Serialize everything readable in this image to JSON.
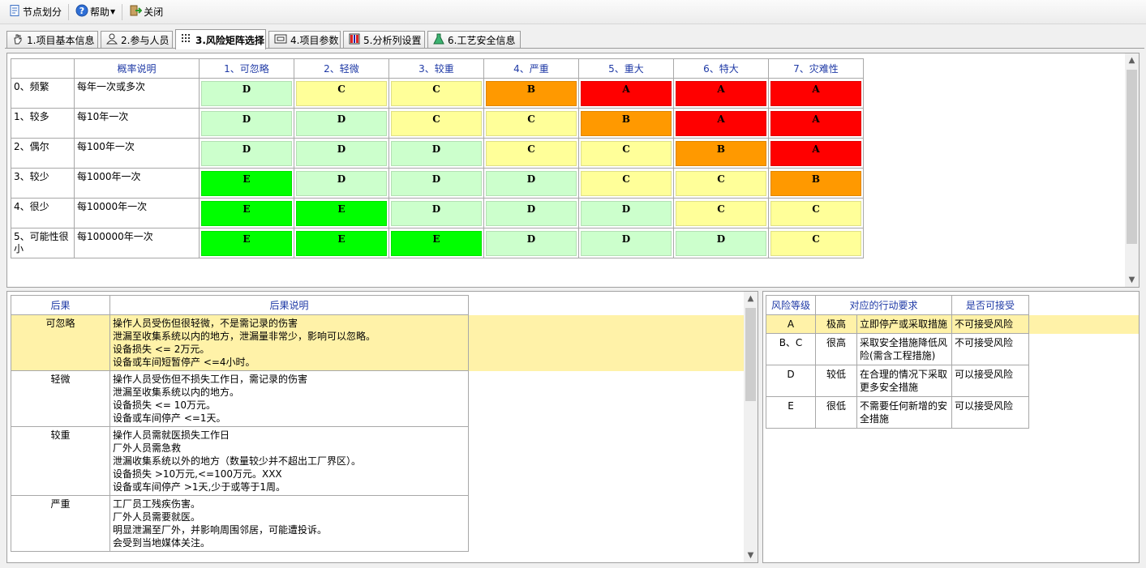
{
  "toolbar": {
    "node_split": "节点划分",
    "help": "帮助",
    "close": "关闭"
  },
  "tabs": [
    {
      "label": "1.项目基本信息",
      "icon": "hand-icon"
    },
    {
      "label": "2.参与人员",
      "icon": "people-icon"
    },
    {
      "label": "3.风险矩阵选择",
      "icon": "grid-icon"
    },
    {
      "label": "4.项目参数",
      "icon": "parameter-icon"
    },
    {
      "label": "5.分析列设置",
      "icon": "columns-icon"
    },
    {
      "label": "6.工艺安全信息",
      "icon": "flask-icon"
    }
  ],
  "active_tab": 2,
  "matrix": {
    "header_prob": "概率说明",
    "columns": [
      "1、可忽略",
      "2、轻微",
      "3、较重",
      "4、严重",
      "5、重大",
      "6、特大",
      "7、灾难性"
    ],
    "rows": [
      {
        "label": "0、频繁",
        "desc": "每年一次或多次",
        "cells": [
          "D",
          "C",
          "C",
          "B",
          "A",
          "A",
          "A"
        ]
      },
      {
        "label": "1、较多",
        "desc": "每10年一次",
        "cells": [
          "D",
          "D",
          "C",
          "C",
          "B",
          "A",
          "A"
        ]
      },
      {
        "label": "2、偶尔",
        "desc": "每100年一次",
        "cells": [
          "D",
          "D",
          "D",
          "C",
          "C",
          "B",
          "A"
        ]
      },
      {
        "label": "3、较少",
        "desc": "每1000年一次",
        "cells": [
          "E",
          "D",
          "D",
          "D",
          "C",
          "C",
          "B"
        ]
      },
      {
        "label": "4、很少",
        "desc": "每10000年一次",
        "cells": [
          "E",
          "E",
          "D",
          "D",
          "D",
          "C",
          "C"
        ]
      },
      {
        "label": "5、可能性很小",
        "desc": "每100000年一次",
        "cells": [
          "E",
          "E",
          "E",
          "D",
          "D",
          "D",
          "C"
        ]
      }
    ],
    "colors": [
      [
        "#ccffcc",
        "#ffff99",
        "#ffff99",
        "#ff9900",
        "#ff0000",
        "#ff0000",
        "#ff0000"
      ],
      [
        "#ccffcc",
        "#ccffcc",
        "#ffff99",
        "#ffff99",
        "#ff9900",
        "#ff0000",
        "#ff0000"
      ],
      [
        "#ccffcc",
        "#ccffcc",
        "#ccffcc",
        "#ffff99",
        "#ffff99",
        "#ff9900",
        "#ff0000"
      ],
      [
        "#00ff00",
        "#ccffcc",
        "#ccffcc",
        "#ccffcc",
        "#ffff99",
        "#ffff99",
        "#ff9900"
      ],
      [
        "#00ff00",
        "#00ff00",
        "#ccffcc",
        "#ccffcc",
        "#ccffcc",
        "#ffff99",
        "#ffff99"
      ],
      [
        "#00ff00",
        "#00ff00",
        "#00ff00",
        "#ccffcc",
        "#ccffcc",
        "#ccffcc",
        "#ffff99"
      ]
    ]
  },
  "consequence": {
    "headers": [
      "后果",
      "后果说明"
    ],
    "rows": [
      {
        "name": "可忽略",
        "desc": "操作人员受伤但很轻微，不是需记录的伤害\n泄漏至收集系统以内的地方，泄漏量非常少，影响可以忽略。\n设备损失 <= 2万元。\n设备或车间短暂停产 <=4小时。"
      },
      {
        "name": "轻微",
        "desc": "操作人员受伤但不损失工作日，需记录的伤害\n泄漏至收集系统以内的地方。\n设备损失 <= 10万元。\n设备或车间停产 <=1天。"
      },
      {
        "name": "较重",
        "desc": "操作人员需就医损失工作日\n厂外人员需急救\n泄漏收集系统以外的地方（数量较少并不超出工厂界区）。\n设备损失 >10万元,<=100万元。XXX\n设备或车间停产 >1天,少于或等于1周。"
      },
      {
        "name": "严重",
        "desc": "工厂员工残疾伤害。\n厂外人员需要就医。\n明显泄漏至厂外，并影响周围邻居，可能遭投诉。\n会受到当地媒体关注。"
      }
    ],
    "selected": 0
  },
  "levels": {
    "headers": [
      "风险等级",
      "对应的行动要求",
      "是否可接受"
    ],
    "rows": [
      {
        "grade": "A",
        "degree": "极高",
        "action": "立即停产或采取措施",
        "accept": "不可接受风险"
      },
      {
        "grade": "B、C",
        "degree": "很高",
        "action": "采取安全措施降低风险(需含工程措施)",
        "accept": "不可接受风险"
      },
      {
        "grade": "D",
        "degree": "较低",
        "action": "在合理的情况下采取更多安全措施",
        "accept": "可以接受风险"
      },
      {
        "grade": "E",
        "degree": "很低",
        "action": "不需要任何新增的安全措施",
        "accept": "可以接受风险"
      }
    ],
    "selected": 0
  }
}
